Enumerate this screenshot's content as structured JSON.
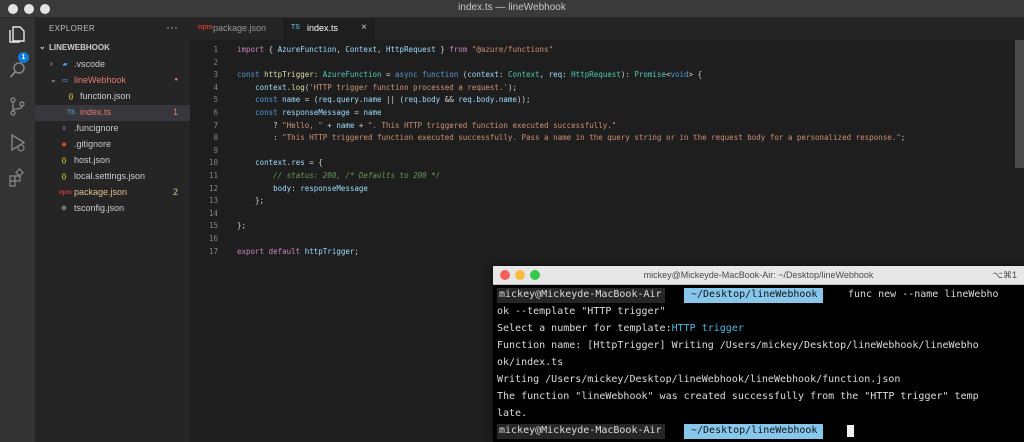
{
  "window": {
    "title": "index.ts — lineWebhook"
  },
  "activity_bar": {
    "explorer_badge": "1"
  },
  "explorer": {
    "header": "EXPLORER",
    "more": "···",
    "root": "LINEWEBHOOK",
    "items": [
      {
        "label": ".vscode",
        "icon": "folder-vscode-icon",
        "chevron": "›",
        "color": "#cccccc"
      },
      {
        "label": "lineWebhook",
        "icon": "folder-open-icon",
        "chevron": "⌄",
        "color": "#e57a6e",
        "badge": "●"
      },
      {
        "label": "function.json",
        "icon": "json-icon",
        "color": "#cccccc"
      },
      {
        "label": "index.ts",
        "icon": "ts-icon",
        "color": "#e57a6e",
        "badge": "1"
      },
      {
        "label": ".funcignore",
        "icon": "file-icon",
        "color": "#cccccc"
      },
      {
        "label": ".gitignore",
        "icon": "git-icon",
        "color": "#cccccc"
      },
      {
        "label": "host.json",
        "icon": "json-icon",
        "color": "#cccccc"
      },
      {
        "label": "local.settings.json",
        "icon": "json-icon",
        "color": "#cccccc"
      },
      {
        "label": "package.json",
        "icon": "npm-icon",
        "color": "#e2c08d",
        "badge": "2"
      },
      {
        "label": "tsconfig.json",
        "icon": "tsconfig-icon",
        "color": "#cccccc"
      }
    ]
  },
  "tabs": [
    {
      "label": "package.json",
      "icon_text": "npm",
      "active": false
    },
    {
      "label": "index.ts",
      "icon_text": "TS",
      "active": true,
      "close": "×"
    }
  ],
  "code_lines": [
    {
      "n": "1",
      "tokens": [
        [
          "kw",
          "import"
        ],
        [
          "pl",
          " { "
        ],
        [
          "var",
          "AzureFunction"
        ],
        [
          "pl",
          ", "
        ],
        [
          "var",
          "Context"
        ],
        [
          "pl",
          ", "
        ],
        [
          "var",
          "HttpRequest"
        ],
        [
          "pl",
          " } "
        ],
        [
          "kw",
          "from"
        ],
        [
          "pl",
          " "
        ],
        [
          "str",
          "\"@azure/functions\""
        ]
      ]
    },
    {
      "n": "2",
      "tokens": []
    },
    {
      "n": "3",
      "tokens": [
        [
          "kwb",
          "const"
        ],
        [
          "pl",
          " "
        ],
        [
          "fn",
          "httpTrigger"
        ],
        [
          "pl",
          ": "
        ],
        [
          "ty",
          "AzureFunction"
        ],
        [
          "pl",
          " = "
        ],
        [
          "kwb",
          "async"
        ],
        [
          "pl",
          " "
        ],
        [
          "kwb",
          "function"
        ],
        [
          "pl",
          " ("
        ],
        [
          "var",
          "context"
        ],
        [
          "pl",
          ": "
        ],
        [
          "ty",
          "Context"
        ],
        [
          "pl",
          ", "
        ],
        [
          "var",
          "req"
        ],
        [
          "pl",
          ": "
        ],
        [
          "ty",
          "HttpRequest"
        ],
        [
          "pl",
          "): "
        ],
        [
          "ty",
          "Promise"
        ],
        [
          "pl",
          "<"
        ],
        [
          "kwb",
          "void"
        ],
        [
          "pl",
          "> {"
        ]
      ]
    },
    {
      "n": "4",
      "tokens": [
        [
          "pl",
          "    "
        ],
        [
          "var",
          "context"
        ],
        [
          "pl",
          "."
        ],
        [
          "fn",
          "log"
        ],
        [
          "pl",
          "("
        ],
        [
          "str",
          "'HTTP trigger function processed a request.'"
        ],
        [
          "pl",
          ");"
        ]
      ]
    },
    {
      "n": "5",
      "tokens": [
        [
          "pl",
          "    "
        ],
        [
          "kwb",
          "const"
        ],
        [
          "pl",
          " "
        ],
        [
          "var",
          "name"
        ],
        [
          "pl",
          " = ("
        ],
        [
          "var",
          "req"
        ],
        [
          "pl",
          "."
        ],
        [
          "var",
          "query"
        ],
        [
          "pl",
          "."
        ],
        [
          "var",
          "name"
        ],
        [
          "pl",
          " || ("
        ],
        [
          "var",
          "req"
        ],
        [
          "pl",
          "."
        ],
        [
          "var",
          "body"
        ],
        [
          "pl",
          " && "
        ],
        [
          "var",
          "req"
        ],
        [
          "pl",
          "."
        ],
        [
          "var",
          "body"
        ],
        [
          "pl",
          "."
        ],
        [
          "var",
          "name"
        ],
        [
          "pl",
          "));"
        ]
      ]
    },
    {
      "n": "6",
      "tokens": [
        [
          "pl",
          "    "
        ],
        [
          "kwb",
          "const"
        ],
        [
          "pl",
          " "
        ],
        [
          "var",
          "responseMessage"
        ],
        [
          "pl",
          " = "
        ],
        [
          "var",
          "name"
        ]
      ]
    },
    {
      "n": "7",
      "tokens": [
        [
          "pl",
          "        ? "
        ],
        [
          "str",
          "\"Hello, \""
        ],
        [
          "pl",
          " + "
        ],
        [
          "var",
          "name"
        ],
        [
          "pl",
          " + "
        ],
        [
          "str",
          "\". This HTTP triggered function executed successfully.\""
        ]
      ]
    },
    {
      "n": "8",
      "tokens": [
        [
          "pl",
          "        : "
        ],
        [
          "str",
          "\"This HTTP triggered function executed successfully. Pass a name in the query string or in the request body for a personalized response.\""
        ],
        [
          "pl",
          ";"
        ]
      ]
    },
    {
      "n": "9",
      "tokens": []
    },
    {
      "n": "10",
      "tokens": [
        [
          "pl",
          "    "
        ],
        [
          "var",
          "context"
        ],
        [
          "pl",
          "."
        ],
        [
          "var",
          "res"
        ],
        [
          "pl",
          " = {"
        ]
      ]
    },
    {
      "n": "11",
      "tokens": [
        [
          "pl",
          "        "
        ],
        [
          "cm",
          "// status: 200, /* Defaults to 200 */"
        ]
      ]
    },
    {
      "n": "12",
      "tokens": [
        [
          "pl",
          "        "
        ],
        [
          "var",
          "body"
        ],
        [
          "pl",
          ": "
        ],
        [
          "var",
          "responseMessage"
        ]
      ]
    },
    {
      "n": "13",
      "tokens": [
        [
          "pl",
          "    };"
        ]
      ]
    },
    {
      "n": "14",
      "tokens": []
    },
    {
      "n": "15",
      "tokens": [
        [
          "pl",
          "};"
        ]
      ]
    },
    {
      "n": "16",
      "tokens": []
    },
    {
      "n": "17",
      "tokens": [
        [
          "kw",
          "export"
        ],
        [
          "pl",
          " "
        ],
        [
          "kw",
          "default"
        ],
        [
          "pl",
          " "
        ],
        [
          "var",
          "httpTrigger"
        ],
        [
          "pl",
          ";"
        ]
      ]
    }
  ],
  "terminal": {
    "title": "mickey@Mickeyde-MacBook-Air: ~/Desktop/lineWebhook",
    "shortcut": "⌥⌘1",
    "prompt_user": "mickey@Mickeyde-MacBook-Air",
    "prompt_path": "~/Desktop/lineWebhook",
    "command": "func new --name lineWebho",
    "command_wrap": "ok --template \"HTTP trigger\"",
    "select_label": "Select a number for template:",
    "select_value": "HTTP trigger",
    "output_1": "Function name: [HttpTrigger] Writing /Users/mickey/Desktop/lineWebhook/lineWebho",
    "output_1_wrap": "ok/index.ts",
    "output_2": "Writing /Users/mickey/Desktop/lineWebhook/lineWebhook/function.json",
    "output_3": "The function \"lineWebhook\" was created successfully from the \"HTTP trigger\" temp",
    "output_3_wrap": "late."
  }
}
